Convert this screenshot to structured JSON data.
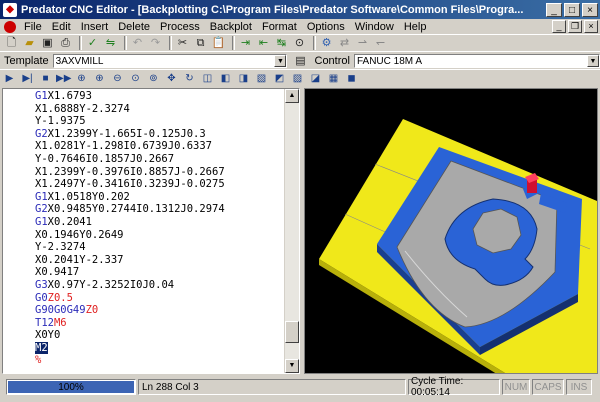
{
  "window": {
    "title": "Predator CNC Editor - [Backplotting C:\\Program Files\\Predator Software\\Common Files\\Progra..."
  },
  "menu": [
    "File",
    "Edit",
    "Insert",
    "Delete",
    "Process",
    "Backplot",
    "Format",
    "Options",
    "Window",
    "Help"
  ],
  "template": {
    "label": "Template",
    "value": "3AXVMILL"
  },
  "control": {
    "label": "Control",
    "value": "FANUC 18M A"
  },
  "toolbar_icons": [
    "new-file-icon",
    "open-folder-icon",
    "save-icon",
    "print-icon",
    "check-icon",
    "undo-icon",
    "redo-icon",
    "cut-icon",
    "copy-icon",
    "paste-icon",
    "find-icon",
    "binoculars-icon"
  ],
  "code_lines": [
    [
      {
        "t": "G1",
        "c": "cmd"
      },
      {
        "t": "X1.6793",
        "c": ""
      }
    ],
    [
      {
        "t": "",
        "c": ""
      },
      {
        "t": "X1.6888Y-2.3274",
        "c": ""
      }
    ],
    [
      {
        "t": "",
        "c": ""
      },
      {
        "t": "Y-1.9375",
        "c": ""
      }
    ],
    [
      {
        "t": "G2",
        "c": "cmd"
      },
      {
        "t": "X1.2399Y-1.665I-0.125J0.3",
        "c": ""
      }
    ],
    [
      {
        "t": "",
        "c": ""
      },
      {
        "t": "X1.0281Y-1.298I0.6739J0.6337",
        "c": ""
      }
    ],
    [
      {
        "t": "",
        "c": ""
      },
      {
        "t": "Y-0.7646I0.1857J0.2667",
        "c": ""
      }
    ],
    [
      {
        "t": "",
        "c": ""
      },
      {
        "t": "X1.2399Y-0.3976I0.8857J-0.2667",
        "c": ""
      }
    ],
    [
      {
        "t": "",
        "c": ""
      },
      {
        "t": "X1.2497Y-0.3416I0.3239J-0.0275",
        "c": ""
      }
    ],
    [
      {
        "t": "G1",
        "c": "cmd"
      },
      {
        "t": "X1.0518Y0.202",
        "c": ""
      }
    ],
    [
      {
        "t": "G2",
        "c": "cmd"
      },
      {
        "t": "X0.9485Y0.2744I0.1312J0.2974",
        "c": ""
      }
    ],
    [
      {
        "t": "G1",
        "c": "cmd"
      },
      {
        "t": "X0.2041",
        "c": ""
      }
    ],
    [
      {
        "t": "",
        "c": ""
      },
      {
        "t": "X0.1946Y0.2649",
        "c": ""
      }
    ],
    [
      {
        "t": "",
        "c": ""
      },
      {
        "t": "Y-2.3274",
        "c": ""
      }
    ],
    [
      {
        "t": "",
        "c": ""
      },
      {
        "t": "X0.2041Y-2.337",
        "c": ""
      }
    ],
    [
      {
        "t": "",
        "c": ""
      },
      {
        "t": "X0.9417",
        "c": ""
      }
    ],
    [
      {
        "t": "G3",
        "c": "cmd"
      },
      {
        "t": "X0.97Y-2.3252I0J0.04",
        "c": ""
      }
    ],
    [
      {
        "t": "G0",
        "c": "cmd"
      },
      {
        "t": "Z0.5",
        "c": "red"
      }
    ],
    [
      {
        "t": "G90G0G49",
        "c": "cmd"
      },
      {
        "t": "Z0",
        "c": "red"
      }
    ],
    [
      {
        "t": "T12",
        "c": "cmd"
      },
      {
        "t": "M6",
        "c": "red"
      }
    ],
    [
      {
        "t": "",
        "c": ""
      },
      {
        "t": "X0Y0",
        "c": ""
      }
    ],
    [
      {
        "t": "M2",
        "c": "sel"
      }
    ],
    [
      {
        "t": "%",
        "c": "pct"
      }
    ]
  ],
  "status": {
    "progress_label": "100%",
    "progress_fraction": 1.0,
    "position": "Ln 288 Col 3",
    "cycle_time": "Cycle Time: 00:05:14",
    "num": "NUM",
    "caps": "CAPS",
    "ins": "INS"
  },
  "colors": {
    "title_start": "#0a246a",
    "title_end": "#3a6ea5",
    "fixture": "#f0e81a",
    "part": "#2a63d6",
    "pocket": "#a9a9a9",
    "tool": "#d01030"
  }
}
